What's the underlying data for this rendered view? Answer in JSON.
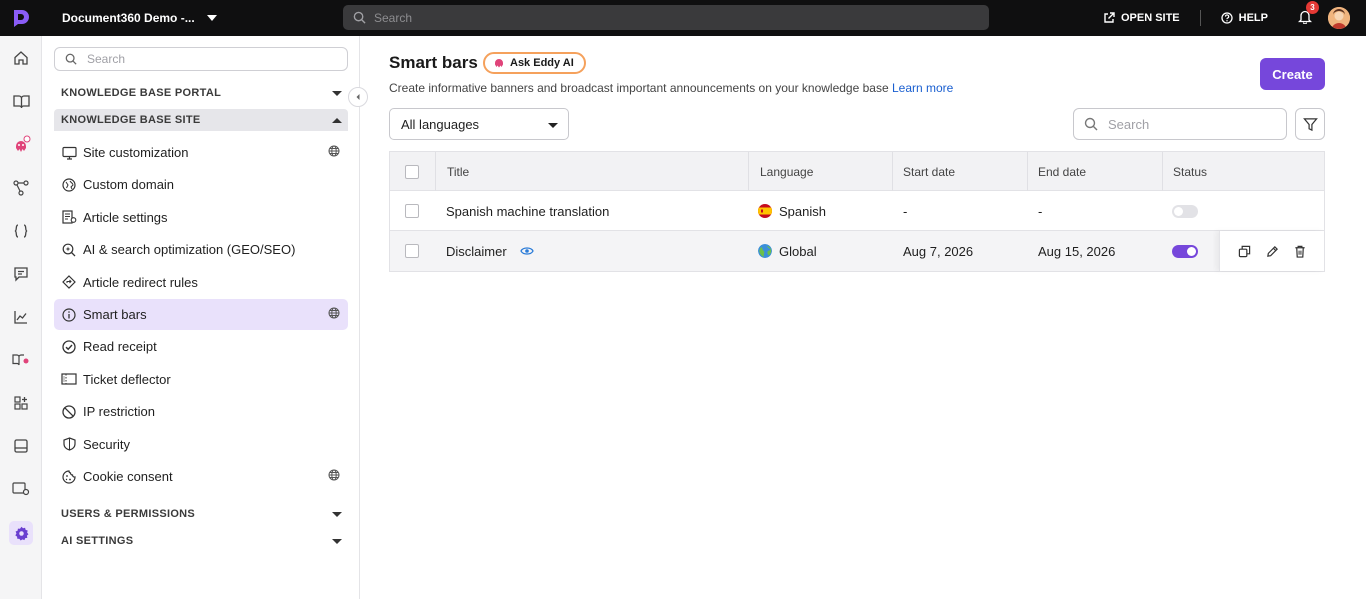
{
  "topbar": {
    "project_name": "Document360 Demo -...",
    "search_placeholder": "Search",
    "open_site_label": "OPEN SITE",
    "help_label": "HELP",
    "notification_count": "3"
  },
  "sidebar": {
    "search_placeholder": "Search",
    "sections": {
      "portal": "KNOWLEDGE BASE PORTAL",
      "site": "KNOWLEDGE BASE SITE",
      "users": "USERS & PERMISSIONS",
      "ai": "AI SETTINGS"
    },
    "items": [
      {
        "label": "Site customization",
        "icon": "monitor-icon",
        "globe": true
      },
      {
        "label": "Custom domain",
        "icon": "domain-icon",
        "globe": false
      },
      {
        "label": "Article settings",
        "icon": "article-settings-icon",
        "globe": false
      },
      {
        "label": "AI & search optimization (GEO/SEO)",
        "icon": "search-optimization-icon",
        "globe": false
      },
      {
        "label": "Article redirect rules",
        "icon": "redirect-icon",
        "globe": false
      },
      {
        "label": "Smart bars",
        "icon": "info-icon",
        "globe": true,
        "active": true
      },
      {
        "label": "Read receipt",
        "icon": "check-circle-icon",
        "globe": false
      },
      {
        "label": "Ticket deflector",
        "icon": "ticket-icon",
        "globe": false
      },
      {
        "label": "IP restriction",
        "icon": "block-icon",
        "globe": false
      },
      {
        "label": "Security",
        "icon": "shield-icon",
        "globe": false
      },
      {
        "label": "Cookie consent",
        "icon": "cookie-icon",
        "globe": true
      }
    ]
  },
  "main": {
    "title": "Smart bars",
    "ask_eddy_label": "Ask Eddy AI",
    "subtitle": "Create informative banners and broadcast important announcements on your knowledge base",
    "learn_more": "Learn more",
    "create_label": "Create",
    "language_filter": "All languages",
    "search_placeholder": "Search"
  },
  "table": {
    "columns": [
      "Title",
      "Language",
      "Start date",
      "End date",
      "Status"
    ],
    "rows": [
      {
        "title": "Spanish machine translation",
        "language": "Spanish",
        "start": "-",
        "end": "-",
        "status": "off"
      },
      {
        "title": "Disclaimer",
        "language": "Global",
        "start": "Aug 7, 2026",
        "end": "Aug 15, 2026",
        "status": "on"
      }
    ]
  },
  "colors": {
    "accent": "#7647db",
    "topbar": "#0f0f10",
    "active_nav": "#e9e1fb",
    "link": "#1a5fd0",
    "eddy_border": "#f5a15c"
  }
}
